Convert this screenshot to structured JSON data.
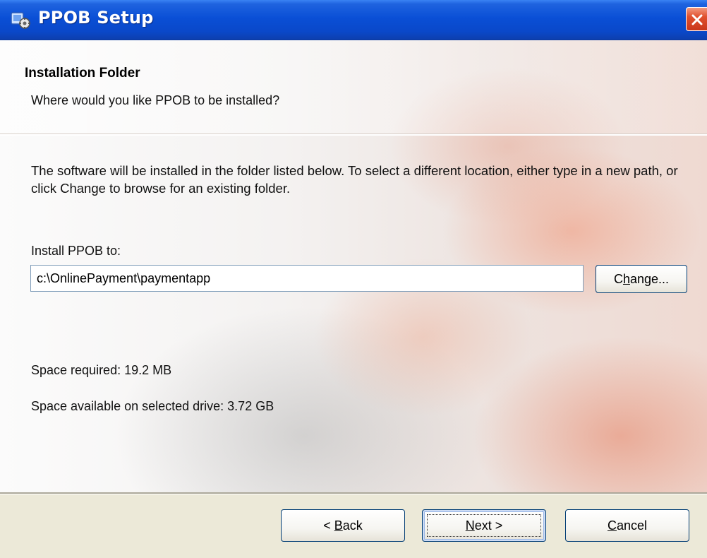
{
  "window": {
    "title": "PPOB Setup"
  },
  "header": {
    "heading": "Installation Folder",
    "subheading": "Where would you like PPOB to be installed?"
  },
  "main": {
    "description": "The software will be installed in the folder listed below. To select a different location, either type in a new path, or click Change to browse for an existing folder.",
    "install_label": "Install PPOB to:",
    "install_path": "c:\\OnlinePayment\\paymentapp",
    "change_label_pre": "C",
    "change_label_key": "h",
    "change_label_post": "ange...",
    "space_required": "Space required: 19.2 MB",
    "space_available": "Space available on selected drive: 3.72 GB"
  },
  "footer": {
    "back_pre": "< ",
    "back_key": "B",
    "back_post": "ack",
    "next_key": "N",
    "next_post": "ext >",
    "cancel_key": "C",
    "cancel_post": "ancel"
  },
  "colors": {
    "titlebar": "#0a4fd6",
    "close_button": "#e0502e",
    "dialog_face": "#ece9d8",
    "button_border": "#003c74"
  },
  "icons": {
    "title": "setup-installer-icon",
    "close": "close-icon"
  }
}
